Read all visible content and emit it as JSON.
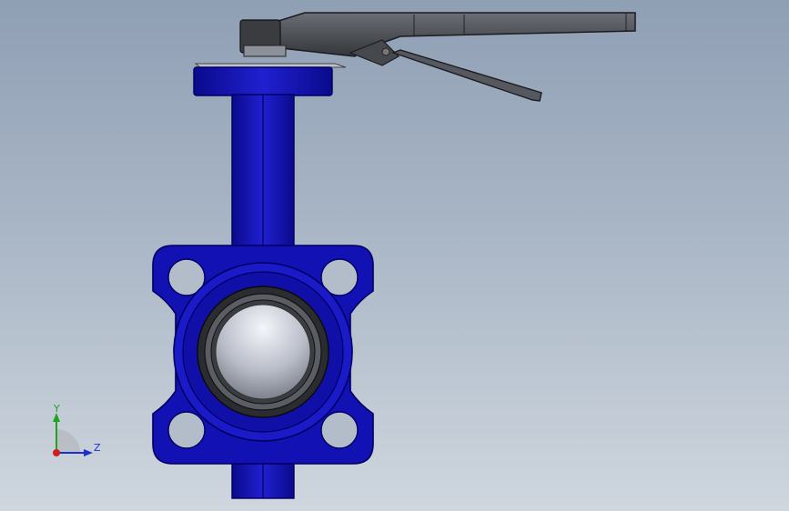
{
  "viewport": {
    "background_top": "#8f9fb4",
    "background_bottom": "#cfd6de"
  },
  "model": {
    "part": "butterfly-valve",
    "body_color": "#1414b8",
    "handle_color": "#4a4d52",
    "disc_color": "#c8ccd6"
  },
  "triad": {
    "y_label": "Y",
    "z_label": "Z",
    "y_color": "#1ea51e",
    "z_color": "#1e2fd0",
    "x_color": "#d01e1e"
  }
}
